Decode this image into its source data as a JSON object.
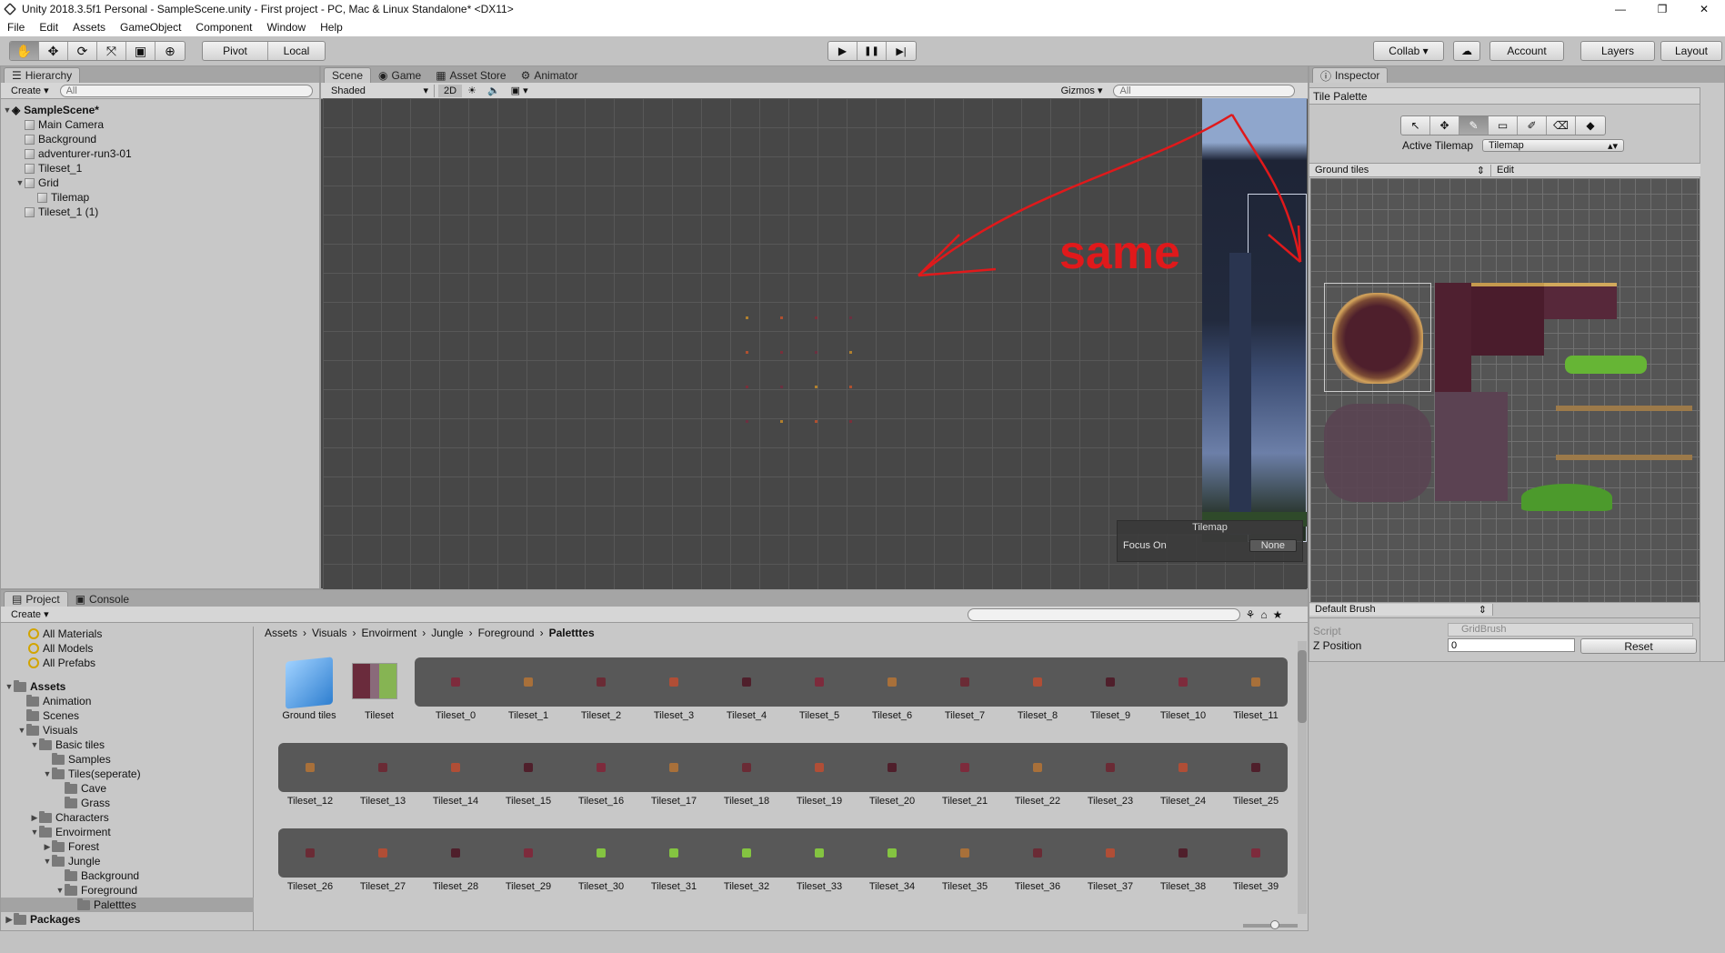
{
  "window": {
    "title": "Unity 2018.3.5f1 Personal - SampleScene.unity - First project - PC, Mac & Linux Standalone* <DX11>",
    "min": "—",
    "max": "❐",
    "close": "✕"
  },
  "menu": [
    "File",
    "Edit",
    "Assets",
    "GameObject",
    "Component",
    "Window",
    "Help"
  ],
  "toolbar": {
    "tools": [
      "✋",
      "✥",
      "⟳",
      "⤧",
      "▣",
      "⊕"
    ],
    "pivot": "Pivot",
    "local": "Local",
    "play": "▶",
    "pause": "❚❚",
    "step": "▶|",
    "collab": "Collab ▾",
    "cloud": "☁",
    "account": "Account",
    "layers": "Layers",
    "layout": "Layout"
  },
  "hierarchy": {
    "tab": "Hierarchy",
    "create": "Create ▾",
    "search_placeholder": "All",
    "scene": "SampleScene*",
    "items": [
      {
        "label": "Main Camera",
        "depth": 1
      },
      {
        "label": "Background",
        "depth": 1
      },
      {
        "label": "adventurer-run3-01",
        "depth": 1
      },
      {
        "label": "Tileset_1",
        "depth": 1
      },
      {
        "label": "Grid",
        "depth": 1,
        "expanded": true
      },
      {
        "label": "Tilemap",
        "depth": 2
      },
      {
        "label": "Tileset_1 (1)",
        "depth": 1
      }
    ]
  },
  "scene": {
    "tabs": [
      "Scene",
      "Game",
      "Asset Store",
      "Animator"
    ],
    "shading": "Shaded",
    "mode2d": "2D",
    "gizmos": "Gizmos ▾",
    "search_placeholder": "All",
    "annotation": "same",
    "overlay_title": "Tilemap",
    "focus_label": "Focus On",
    "focus_value": "None"
  },
  "inspector": {
    "tab": "Inspector"
  },
  "tile_palette": {
    "title": "Tile Palette",
    "active_tilemap_label": "Active Tilemap",
    "active_tilemap_value": "Tilemap",
    "palette": "Ground tiles",
    "edit": "Edit",
    "brush": "Default Brush",
    "script_label": "Script",
    "script_value": "GridBrush",
    "zpos_label": "Z Position",
    "zpos_value": "0",
    "reset": "Reset"
  },
  "project": {
    "tabs": [
      "Project",
      "Console"
    ],
    "create": "Create ▾",
    "favorites": [
      "All Materials",
      "All Models",
      "All Prefabs"
    ],
    "tree": [
      {
        "label": "Assets",
        "depth": 0,
        "bold": true
      },
      {
        "label": "Animation",
        "depth": 1
      },
      {
        "label": "Scenes",
        "depth": 1
      },
      {
        "label": "Visuals",
        "depth": 1
      },
      {
        "label": "Basic tiles",
        "depth": 2
      },
      {
        "label": "Samples",
        "depth": 3
      },
      {
        "label": "Tiles(seperate)",
        "depth": 3
      },
      {
        "label": "Cave",
        "depth": 4
      },
      {
        "label": "Grass",
        "depth": 4
      },
      {
        "label": "Characters",
        "depth": 2
      },
      {
        "label": "Envoirment",
        "depth": 2
      },
      {
        "label": "Forest",
        "depth": 3
      },
      {
        "label": "Jungle",
        "depth": 3
      },
      {
        "label": "Background",
        "depth": 4
      },
      {
        "label": "Foreground",
        "depth": 4
      },
      {
        "label": "Paletttes",
        "depth": 5,
        "selected": true
      },
      {
        "label": "Packages",
        "depth": 0,
        "bold": true
      }
    ],
    "breadcrumb": [
      "Assets",
      "Visuals",
      "Envoirment",
      "Jungle",
      "Foreground",
      "Paletttes"
    ],
    "assets_row0_first": [
      "Ground tiles",
      "Tileset"
    ],
    "assets_row0": [
      "Tileset_0",
      "Tileset_1",
      "Tileset_2",
      "Tileset_3",
      "Tileset_4",
      "Tileset_5",
      "Tileset_6",
      "Tileset_7",
      "Tileset_8",
      "Tileset_9",
      "Tileset_10",
      "Tileset_11"
    ],
    "assets_row1": [
      "Tileset_12",
      "Tileset_13",
      "Tileset_14",
      "Tileset_15",
      "Tileset_16",
      "Tileset_17",
      "Tileset_18",
      "Tileset_19",
      "Tileset_20",
      "Tileset_21",
      "Tileset_22",
      "Tileset_23",
      "Tileset_24",
      "Tileset_25"
    ],
    "assets_row2": [
      "Tileset_26",
      "Tileset_27",
      "Tileset_28",
      "Tileset_29",
      "Tileset_30",
      "Tileset_31",
      "Tileset_32",
      "Tileset_33",
      "Tileset_34",
      "Tileset_35",
      "Tileset_36",
      "Tileset_37",
      "Tileset_38",
      "Tileset_39"
    ]
  }
}
